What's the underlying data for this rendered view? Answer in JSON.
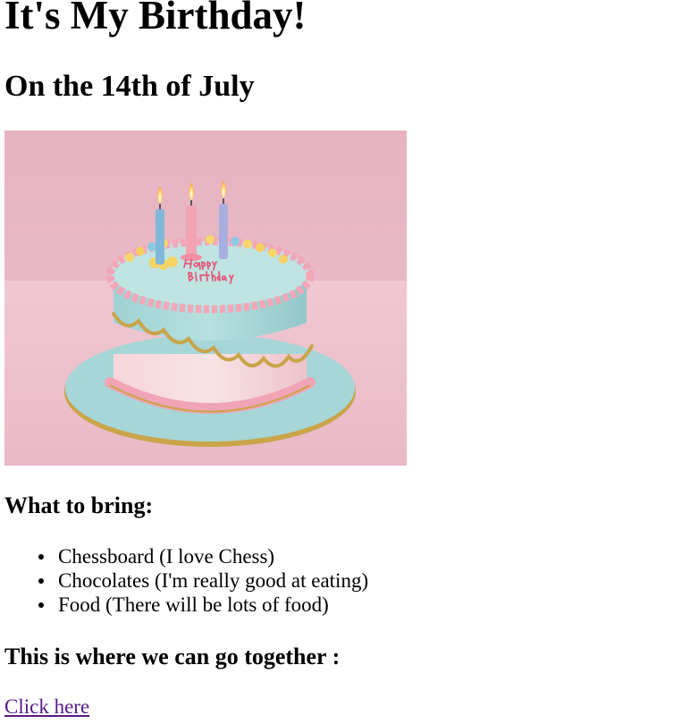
{
  "page": {
    "title": "It's My Birthday!",
    "subtitle": "On the 14th of July"
  },
  "image": {
    "alt": "Birthday cake with three candles",
    "cake_text": "Happy Birthday",
    "colors": {
      "background": "#e8b7c4",
      "table": "#efc8d2",
      "plate": "#9fd3d6",
      "frosting_blue": "#a8d8d8",
      "cake_pink": "#f4c9cf",
      "gold_trim": "#c9a449",
      "piping_pink": "#f2a3b6"
    }
  },
  "bring": {
    "heading": "What to bring:",
    "items": [
      "Chessboard (I love Chess)",
      "Chocolates (I'm really good at eating)",
      "Food (There will be lots of food)"
    ]
  },
  "where": {
    "heading": "This is where we can go together :",
    "link_label": "Click here",
    "link_color": "#551a8b"
  }
}
